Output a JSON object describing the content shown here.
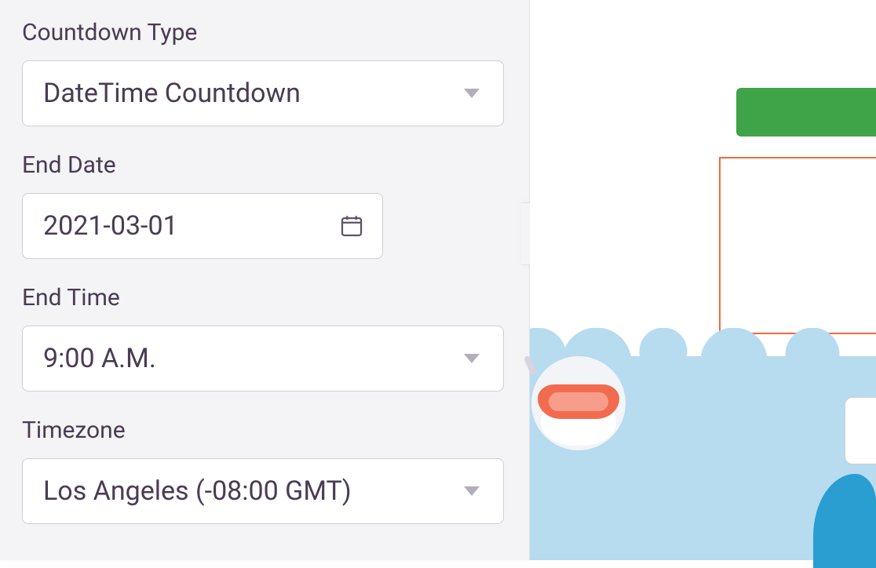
{
  "panel": {
    "countdown_type": {
      "label": "Countdown Type",
      "value": "DateTime Countdown"
    },
    "end_date": {
      "label": "End Date",
      "value": "2021-03-01"
    },
    "end_time": {
      "label": "End Time",
      "value": "9:00 A.M."
    },
    "timezone": {
      "label": "Timezone",
      "value": "Los Angeles (-08:00 GMT)"
    }
  },
  "colors": {
    "panel_bg": "#f4f3f5",
    "text": "#4a3b54",
    "border": "#d1ced6",
    "green": "#3fa447",
    "orange": "#ef6a3c",
    "sky": "#b7dbef",
    "coral": "#f26b4e",
    "deep_blue": "#2a9ed0"
  }
}
